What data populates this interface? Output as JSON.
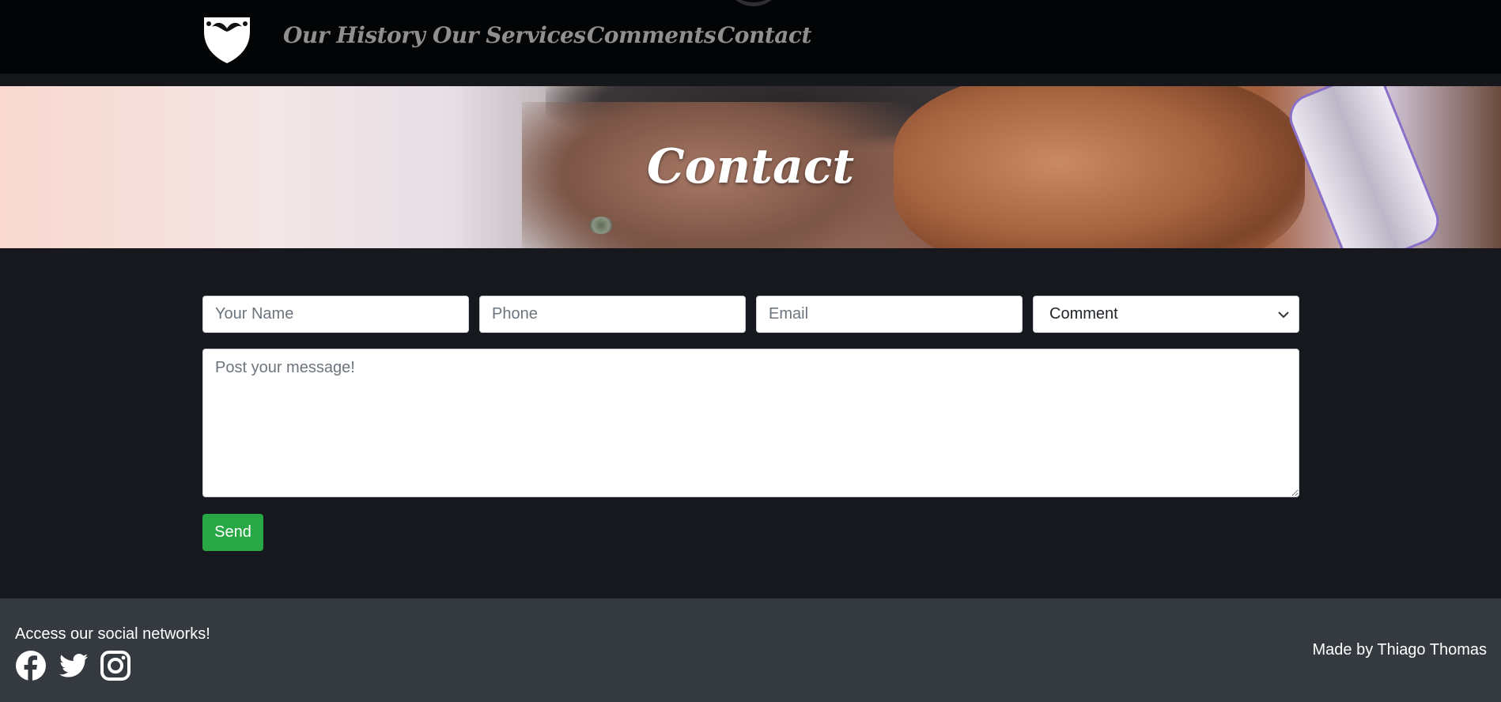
{
  "nav": {
    "items": [
      {
        "label": "Our History"
      },
      {
        "label": "Our Services"
      },
      {
        "label": "Comments"
      },
      {
        "label": "Contact"
      }
    ]
  },
  "hero": {
    "title": "Contact"
  },
  "form": {
    "name_placeholder": "Your Name",
    "phone_placeholder": "Phone",
    "email_placeholder": "Email",
    "type_selected": "Comment",
    "message_placeholder": "Post your message!",
    "send_label": "Send"
  },
  "footer": {
    "social_text": "Access our social networks!",
    "social_icons": [
      "facebook-icon",
      "twitter-icon",
      "instagram-icon"
    ],
    "credit": "Made by Thiago Thomas"
  },
  "colors": {
    "nav_bg": "#030406",
    "page_bg": "#16181d",
    "footer_bg": "#343a40",
    "send_button": "#28a745",
    "nav_link": "#8f8f8f"
  }
}
